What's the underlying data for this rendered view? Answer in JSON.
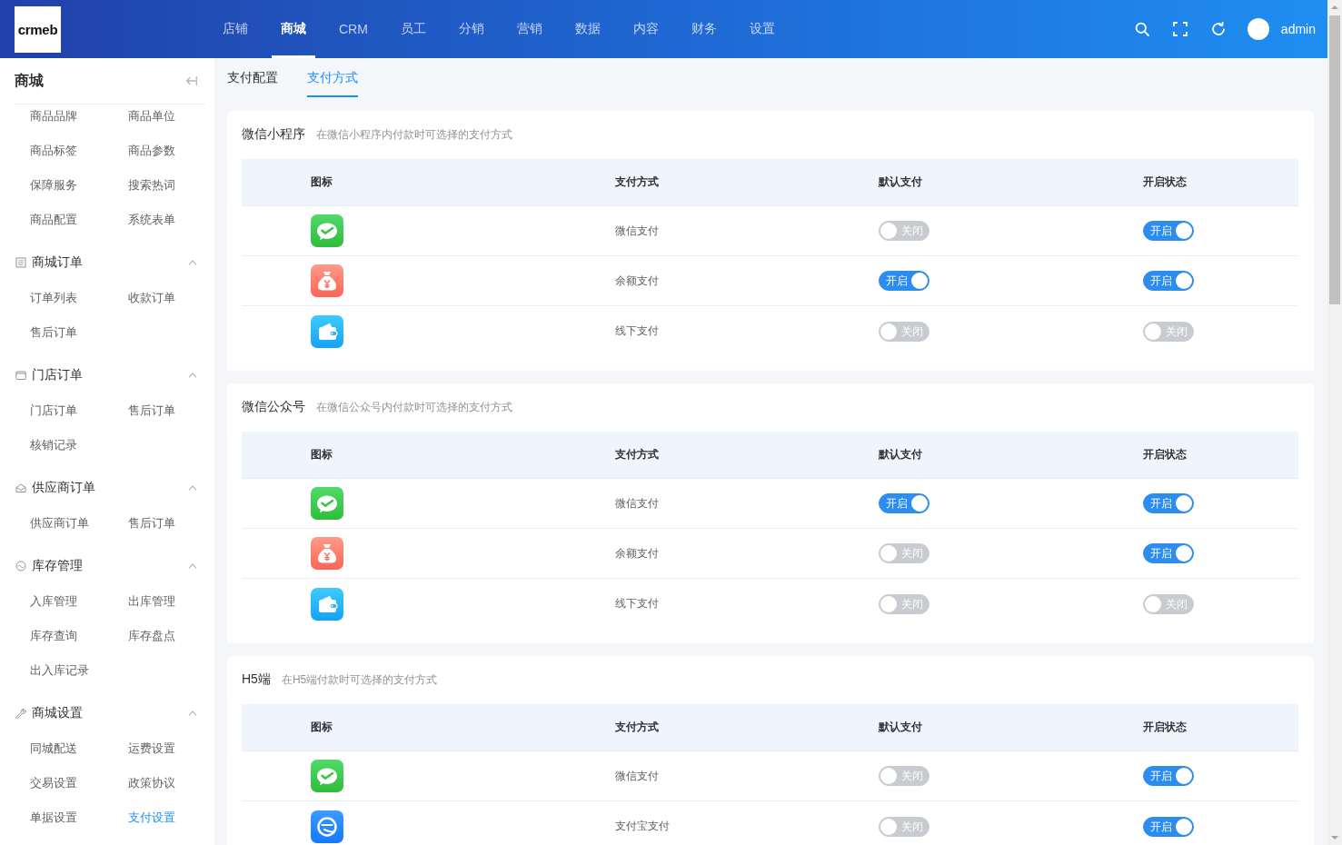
{
  "header": {
    "logo": "crmeb",
    "nav": [
      {
        "label": "店铺",
        "selected": false
      },
      {
        "label": "商城",
        "selected": true
      },
      {
        "label": "CRM",
        "selected": false
      },
      {
        "label": "员工",
        "selected": false
      },
      {
        "label": "分销",
        "selected": false
      },
      {
        "label": "营销",
        "selected": false
      },
      {
        "label": "数据",
        "selected": false
      },
      {
        "label": "内容",
        "selected": false
      },
      {
        "label": "财务",
        "selected": false
      },
      {
        "label": "设置",
        "selected": false
      }
    ],
    "user": "admin"
  },
  "sidebar": {
    "title": "商城",
    "items": [
      {
        "label": "商品品牌",
        "selected": false
      },
      {
        "label": "商品单位",
        "selected": false
      },
      {
        "label": "商品标签",
        "selected": false
      },
      {
        "label": "商品参数",
        "selected": false
      },
      {
        "label": "保障服务",
        "selected": false
      },
      {
        "label": "搜索热词",
        "selected": false
      },
      {
        "label": "商品配置",
        "selected": false
      },
      {
        "label": "系统表单",
        "selected": false
      }
    ],
    "groups": [
      {
        "label": "商城订单",
        "expanded": true,
        "items": [
          {
            "label": "订单列表",
            "selected": false
          },
          {
            "label": "收款订单",
            "selected": false
          },
          {
            "label": "售后订单",
            "selected": false
          }
        ]
      },
      {
        "label": "门店订单",
        "expanded": true,
        "items": [
          {
            "label": "门店订单",
            "selected": false
          },
          {
            "label": "售后订单",
            "selected": false
          },
          {
            "label": "核销记录",
            "selected": false
          }
        ]
      },
      {
        "label": "供应商订单",
        "expanded": true,
        "items": [
          {
            "label": "供应商订单",
            "selected": false
          },
          {
            "label": "售后订单",
            "selected": false
          }
        ]
      },
      {
        "label": "库存管理",
        "expanded": true,
        "items": [
          {
            "label": "入库管理",
            "selected": false
          },
          {
            "label": "出库管理",
            "selected": false
          },
          {
            "label": "库存查询",
            "selected": false
          },
          {
            "label": "库存盘点",
            "selected": false
          },
          {
            "label": "出入库记录",
            "selected": false
          }
        ]
      },
      {
        "label": "商城设置",
        "expanded": true,
        "items": [
          {
            "label": "同城配送",
            "selected": false
          },
          {
            "label": "运费设置",
            "selected": false
          },
          {
            "label": "交易设置",
            "selected": false
          },
          {
            "label": "政策协议",
            "selected": false
          },
          {
            "label": "单据设置",
            "selected": false
          },
          {
            "label": "支付设置",
            "selected": true
          }
        ]
      }
    ]
  },
  "tabs": [
    {
      "label": "支付配置",
      "selected": false
    },
    {
      "label": "支付方式",
      "selected": true
    }
  ],
  "sections": [
    {
      "title": "微信小程序",
      "description": "在微信小程序内付款时可选择的支付方式",
      "columns": [
        "图标",
        "支付方式",
        "默认支付",
        "开启状态"
      ],
      "rows": [
        {
          "kind": "wechat",
          "name": "微信支付",
          "default": {
            "on": false,
            "label": "关闭"
          },
          "enabled": {
            "on": true,
            "label": "开启"
          }
        },
        {
          "kind": "balance",
          "name": "余额支付",
          "default": {
            "on": true,
            "label": "开启"
          },
          "enabled": {
            "on": true,
            "label": "开启"
          }
        },
        {
          "kind": "offline",
          "name": "线下支付",
          "default": {
            "on": false,
            "label": "关闭"
          },
          "enabled": {
            "on": false,
            "label": "关闭"
          }
        }
      ]
    },
    {
      "title": "微信公众号",
      "description": "在微信公众号内付款时可选择的支付方式",
      "columns": [
        "图标",
        "支付方式",
        "默认支付",
        "开启状态"
      ],
      "rows": [
        {
          "kind": "wechat",
          "name": "微信支付",
          "default": {
            "on": true,
            "label": "开启"
          },
          "enabled": {
            "on": true,
            "label": "开启"
          }
        },
        {
          "kind": "balance",
          "name": "余额支付",
          "default": {
            "on": false,
            "label": "关闭"
          },
          "enabled": {
            "on": true,
            "label": "开启"
          }
        },
        {
          "kind": "offline",
          "name": "线下支付",
          "default": {
            "on": false,
            "label": "关闭"
          },
          "enabled": {
            "on": false,
            "label": "关闭"
          }
        }
      ]
    },
    {
      "title": "H5端",
      "description": "在H5端付款时可选择的支付方式",
      "columns": [
        "图标",
        "支付方式",
        "默认支付",
        "开启状态"
      ],
      "rows": [
        {
          "kind": "wechat",
          "name": "微信支付",
          "default": {
            "on": false,
            "label": "关闭"
          },
          "enabled": {
            "on": true,
            "label": "开启"
          }
        },
        {
          "kind": "alipay",
          "name": "支付宝支付",
          "default": {
            "on": false,
            "label": "关闭"
          },
          "enabled": {
            "on": true,
            "label": "开启"
          }
        }
      ]
    }
  ]
}
